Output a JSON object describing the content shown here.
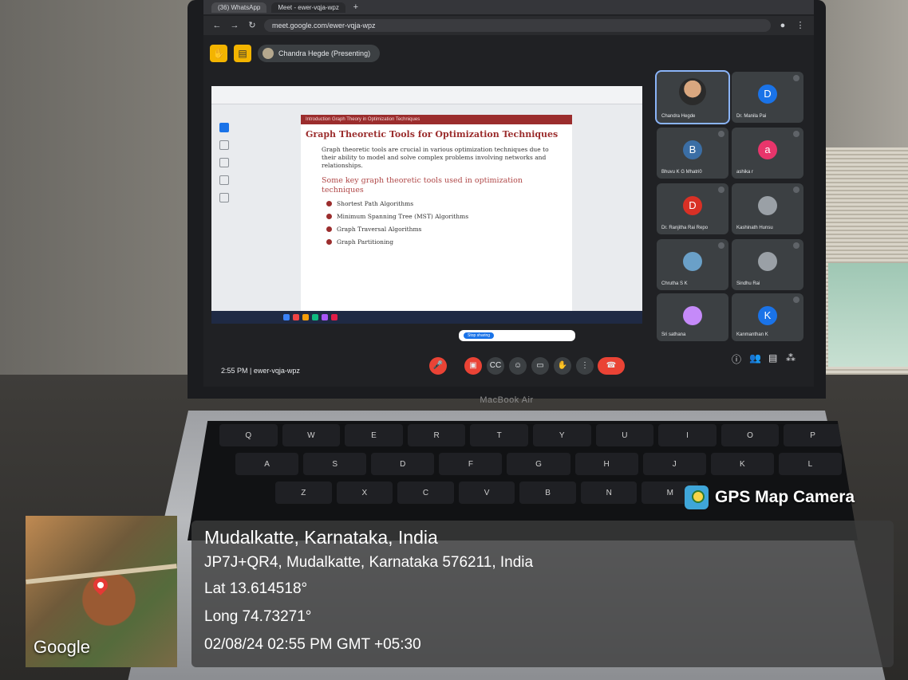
{
  "browser": {
    "tabs": [
      "(36) WhatsApp",
      "Meet - ewer-vqja-wpz"
    ],
    "url": "meet.google.com/ewer-vqja-wpz"
  },
  "meet": {
    "presenting_label": "Chandra Hegde (Presenting)",
    "time_and_code": "2:55 PM  |  ewer-vqja-wpz",
    "stop_sharing_label": "Stop sharing",
    "participants": [
      {
        "name": "Chandra Hegde",
        "initial": "",
        "color": "#b5a88e",
        "type": "photo"
      },
      {
        "name": "Dr. Manila Pai",
        "initial": "D",
        "color": "#1a73e8",
        "type": "avatar"
      },
      {
        "name": "Bhuvu K G Mhatri0",
        "initial": "B",
        "color": "#3b6ea5",
        "type": "avatar"
      },
      {
        "name": "ashika r",
        "initial": "a",
        "color": "#e8356b",
        "type": "avatar"
      },
      {
        "name": "Dr. Ranjitha Rai Repo",
        "initial": "D",
        "color": "#d93025",
        "type": "avatar"
      },
      {
        "name": "Kashinath Hunsu",
        "initial": "",
        "color": "#9aa0a6",
        "type": "photo"
      },
      {
        "name": "Chrutha S K",
        "initial": "",
        "color": "#6aa0c8",
        "type": "photo"
      },
      {
        "name": "Sindhu Rai",
        "initial": "",
        "color": "#9aa0a6",
        "type": "photo"
      },
      {
        "name": "Sri sathana",
        "initial": "",
        "color": "#c58af9",
        "type": "photo"
      },
      {
        "name": "Kanmanthan K",
        "initial": "K",
        "color": "#1a73e8",
        "type": "avatar"
      }
    ]
  },
  "document": {
    "banner": "Introduction  Graph Theory in Optimization Techniques",
    "title": "Graph Theoretic Tools for Optimization Techniques",
    "intro": "Graph theoretic tools are crucial in various optimization techniques due to their ability to model and solve complex problems involving networks and relationships.",
    "subheading": "Some key graph theoretic tools used in optimization techniques",
    "items": [
      "Shortest Path Algorithms",
      "Minimum Spanning Tree (MST) Algorithms",
      "Graph Traversal Algorithms",
      "Graph Partitioning"
    ]
  },
  "device_label": "MacBook Air",
  "gps": {
    "brand": "GPS Map Camera",
    "place": "Mudalkatte, Karnataka, India",
    "address": "JP7J+QR4, Mudalkatte, Karnataka 576211, India",
    "lat": "Lat 13.614518°",
    "long": "Long 74.73271°",
    "datetime": "02/08/24 02:55 PM GMT +05:30",
    "map_watermark": "Google"
  },
  "keyboard_rows": [
    [
      "Q",
      "W",
      "E",
      "R",
      "T",
      "Y",
      "U",
      "I",
      "O",
      "P"
    ],
    [
      "A",
      "S",
      "D",
      "F",
      "G",
      "H",
      "J",
      "K",
      "L"
    ],
    [
      "Z",
      "X",
      "C",
      "V",
      "B",
      "N",
      "M"
    ]
  ]
}
